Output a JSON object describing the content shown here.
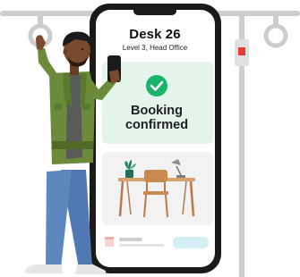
{
  "booking": {
    "desk_name": "Desk 26",
    "location": "Level 3, Head Office",
    "status_line1": "Booking",
    "status_line2": "confirmed"
  },
  "colors": {
    "confirmed_bg": "#e3f5ea",
    "confirmed_check": "#19b46a",
    "phone_body": "#1a1a1a",
    "pole": "#cdcdcd",
    "handle_marker": "#e53935",
    "jacket": "#6b8a3a",
    "jeans": "#4f79b0",
    "skin": "#7a4a2e",
    "shirt": "#5a5a5a"
  },
  "icons": [
    "check-circle-icon",
    "plant-icon",
    "desk-lamp-icon",
    "calendar-icon"
  ]
}
